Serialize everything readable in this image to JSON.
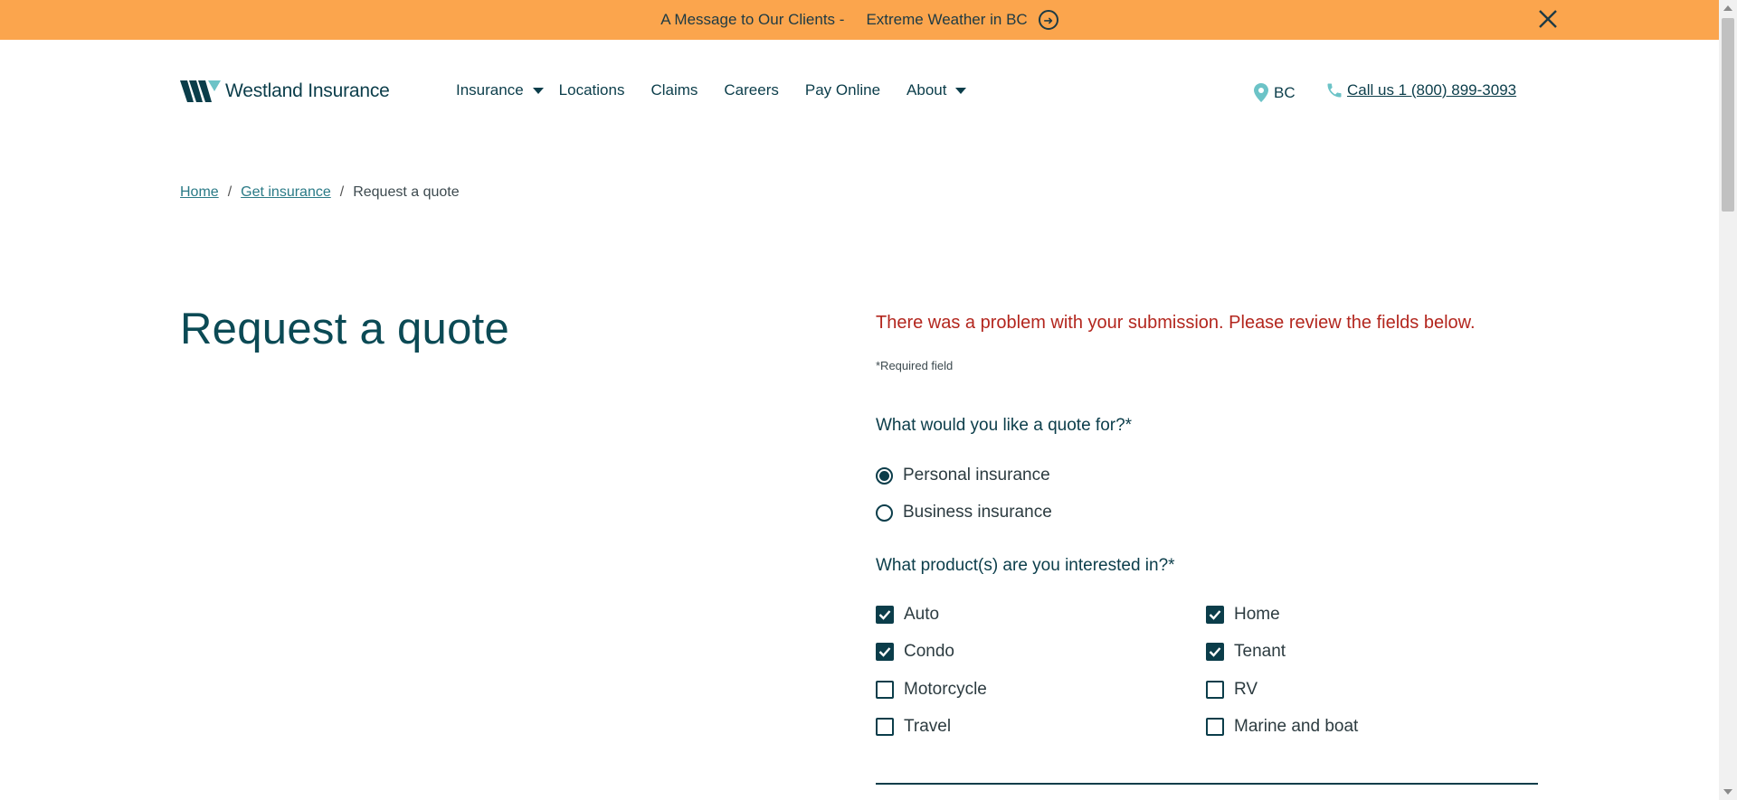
{
  "banner": {
    "message": "A Message to Our Clients -",
    "link_label": "Extreme Weather in BC",
    "arrow_icon": "arrow-circle-right-icon",
    "close_icon": "close-icon",
    "background": "#fba54d"
  },
  "header": {
    "logo_text": "Westland Insurance",
    "nav": [
      {
        "label": "Insurance",
        "has_dropdown": true
      },
      {
        "label": "Locations",
        "has_dropdown": false
      },
      {
        "label": "Claims",
        "has_dropdown": false
      },
      {
        "label": "Careers",
        "has_dropdown": false
      },
      {
        "label": "Pay Online",
        "has_dropdown": false
      },
      {
        "label": "About",
        "has_dropdown": true
      }
    ],
    "region": "BC",
    "phone": "Call us 1 (800) 899-3093"
  },
  "breadcrumb": {
    "home": "Home",
    "get_insurance": "Get insurance",
    "separator": "/",
    "current": "Request a quote"
  },
  "page": {
    "title": "Request a quote"
  },
  "form": {
    "error": "There was a problem with your submission. Please review the fields below.",
    "required_note": "*Required field",
    "quote_for": {
      "label": "What would you like a quote for?*",
      "options": [
        {
          "label": "Personal insurance",
          "selected": true
        },
        {
          "label": "Business insurance",
          "selected": false
        }
      ]
    },
    "products": {
      "label": "What product(s) are you interested in?*",
      "options": [
        {
          "label": "Auto",
          "checked": true
        },
        {
          "label": "Home",
          "checked": true
        },
        {
          "label": "Condo",
          "checked": true
        },
        {
          "label": "Tenant",
          "checked": true
        },
        {
          "label": "Motorcycle",
          "checked": false
        },
        {
          "label": "RV",
          "checked": false
        },
        {
          "label": "Travel",
          "checked": false
        },
        {
          "label": "Marine and boat",
          "checked": false
        }
      ]
    }
  },
  "colors": {
    "brand": "#0b3d4a",
    "link": "#2a7a86",
    "error": "#b3261e",
    "logo_accent": "#6cc3c7"
  }
}
